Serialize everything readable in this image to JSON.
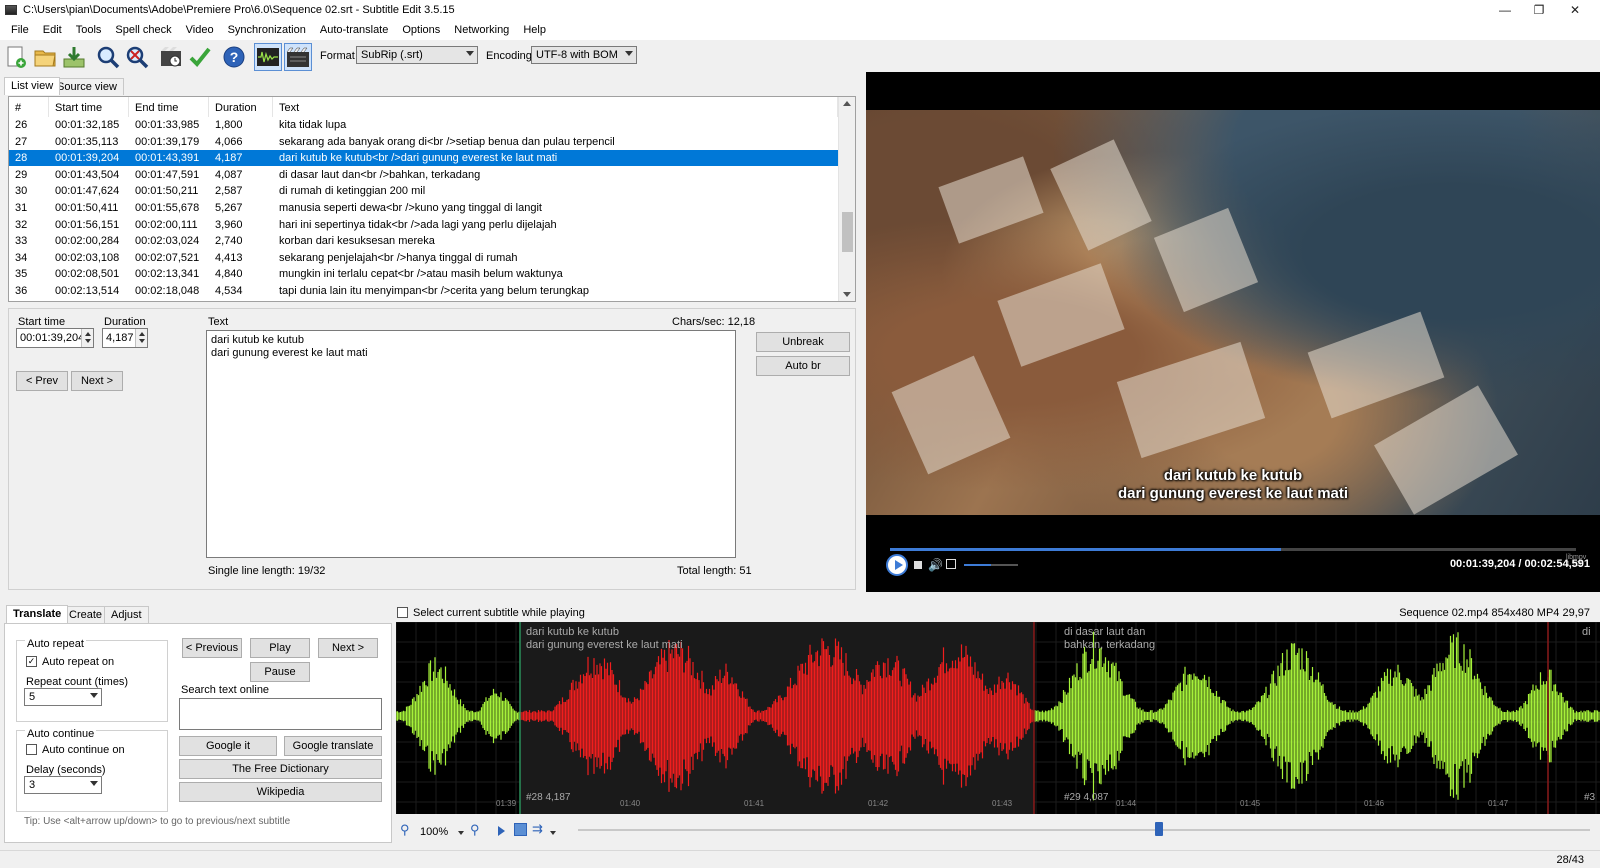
{
  "window": {
    "title": "C:\\Users\\pian\\Documents\\Adobe\\Premiere Pro\\6.0\\Sequence 02.srt - Subtitle Edit 3.5.15"
  },
  "menu": [
    "File",
    "Edit",
    "Tools",
    "Spell check",
    "Video",
    "Synchronization",
    "Auto-translate",
    "Options",
    "Networking",
    "Help"
  ],
  "toolbar": {
    "icons": [
      "new-file-icon",
      "open-folder-icon",
      "save-download-icon",
      "find-icon",
      "replace-icon",
      "visual-sync-icon",
      "spell-check-icon",
      "help-icon",
      "waveform-toggle-icon",
      "video-toggle-icon"
    ],
    "format_label": "Format",
    "format_value": "SubRip (.srt)",
    "encoding_label": "Encoding",
    "encoding_value": "UTF-8 with BOM"
  },
  "view_tabs": [
    "List view",
    "Source view"
  ],
  "list": {
    "columns": [
      "#",
      "Start time",
      "End time",
      "Duration",
      "Text"
    ],
    "rows": [
      [
        "26",
        "00:01:32,185",
        "00:01:33,985",
        "1,800",
        "kita tidak lupa"
      ],
      [
        "27",
        "00:01:35,113",
        "00:01:39,179",
        "4,066",
        "sekarang ada banyak orang di<br />setiap benua dan pulau terpencil"
      ],
      [
        "28",
        "00:01:39,204",
        "00:01:43,391",
        "4,187",
        "dari kutub ke kutub<br />dari gunung everest ke laut mati"
      ],
      [
        "29",
        "00:01:43,504",
        "00:01:47,591",
        "4,087",
        "di dasar laut dan<br />bahkan, terkadang"
      ],
      [
        "30",
        "00:01:47,624",
        "00:01:50,211",
        "2,587",
        "di rumah di ketinggian 200 mil"
      ],
      [
        "31",
        "00:01:50,411",
        "00:01:55,678",
        "5,267",
        "manusia seperti dewa<br />kuno yang tinggal di langit"
      ],
      [
        "32",
        "00:01:56,151",
        "00:02:00,111",
        "3,960",
        "hari ini sepertinya tidak<br />ada lagi yang perlu dijelajah"
      ],
      [
        "33",
        "00:02:00,284",
        "00:02:03,024",
        "2,740",
        "korban dari kesuksesan mereka"
      ],
      [
        "34",
        "00:02:03,108",
        "00:02:07,521",
        "4,413",
        "sekarang penjelajah<br />hanya tinggal di rumah"
      ],
      [
        "35",
        "00:02:08,501",
        "00:02:13,341",
        "4,840",
        "mungkin ini terlalu cepat<br />atau masih belum waktunya"
      ],
      [
        "36",
        "00:02:13,514",
        "00:02:18,048",
        "4,534",
        "tapi dunia lain itu menyimpan<br />cerita yang belum terungkap"
      ]
    ],
    "selected_index": 2
  },
  "edit": {
    "start_time_label": "Start time",
    "start_time_value": "00:01:39,204",
    "duration_label": "Duration",
    "duration_value": "4,187",
    "text_label": "Text",
    "chars_sec": "Chars/sec: 12,18",
    "text_value": "dari kutub ke kutub\ndari gunung everest ke laut mati",
    "prev_label": "< Prev",
    "next_label": "Next >",
    "unbreak_label": "Unbreak",
    "autobr_label": "Auto br",
    "single_line_length": "Single line length: 19/32",
    "total_length": "Total length: 51"
  },
  "video": {
    "caption_line1": "dari kutub ke kutub",
    "caption_line2": "dari gunung everest ke laut mati",
    "time_display": "00:01:39,204 / 00:02:54,591",
    "progress": 0.57,
    "volume": 0.5,
    "mpv_label": "libmpv 1.108"
  },
  "bottom_tabs": [
    "Translate",
    "Create",
    "Adjust"
  ],
  "translate": {
    "auto_repeat_title": "Auto repeat",
    "auto_repeat_on_label": "Auto repeat on",
    "auto_repeat_checked": true,
    "repeat_count_label": "Repeat count (times)",
    "repeat_count_value": "5",
    "auto_continue_title": "Auto continue",
    "auto_continue_on_label": "Auto continue on",
    "auto_continue_checked": false,
    "delay_label": "Delay (seconds)",
    "delay_value": "3",
    "previous_label": "< Previous",
    "play_label": "Play",
    "next_label": "Next >",
    "pause_label": "Pause",
    "search_online_label": "Search text online",
    "google_it_label": "Google it",
    "google_translate_label": "Google translate",
    "free_dictionary_label": "The Free Dictionary",
    "wikipedia_label": "Wikipedia",
    "tip": "Tip: Use <alt+arrow up/down> to go to previous/next subtitle"
  },
  "waveform": {
    "select_while_playing_label": "Select current subtitle while playing",
    "media_info": "Sequence 02.mp4 854x480 MP4 29,97",
    "seg1_line1": "dari kutub ke kutub",
    "seg1_line2": "dari gunung everest ke laut mati",
    "seg1_info": "#28  4,187",
    "seg2_line1": "di dasar laut dan",
    "seg2_line2": "bahkan, terkadang",
    "seg2_info": "#29  4,087",
    "seg3_line1": "di",
    "seg3_info": "#3",
    "ticks": [
      "01:39",
      "01:40",
      "01:41",
      "01:42",
      "01:43",
      "01:44",
      "01:45",
      "01:46",
      "01:47"
    ],
    "zoom": "100%",
    "position": 0.57
  },
  "status": {
    "counter": "28/43"
  }
}
